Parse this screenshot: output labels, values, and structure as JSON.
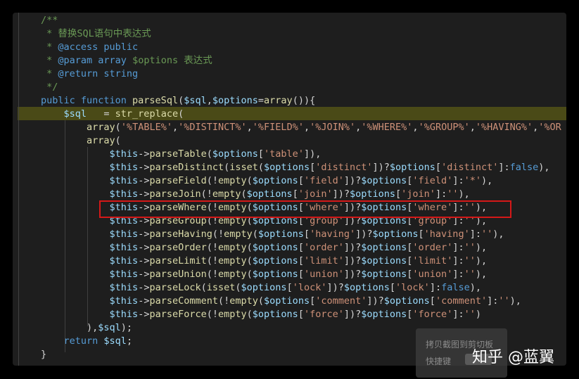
{
  "code": {
    "highlighted_line": 8,
    "lines": [
      [
        [
          "c",
          "/**"
        ]
      ],
      [
        [
          "c",
          " * 替换SQL语句中表达式"
        ]
      ],
      [
        [
          "c",
          " * "
        ],
        [
          "ct",
          "@access public"
        ]
      ],
      [
        [
          "c",
          " * "
        ],
        [
          "ct",
          "@param array "
        ],
        [
          "cv",
          "$options"
        ],
        [
          "c",
          " 表达式"
        ]
      ],
      [
        [
          "c",
          " * "
        ],
        [
          "ct",
          "@return string"
        ]
      ],
      [
        [
          "c",
          " */"
        ]
      ],
      [
        [
          "k",
          "public function "
        ],
        [
          "f",
          "parseSql"
        ],
        [
          "p",
          "("
        ],
        [
          "v",
          "$sql"
        ],
        [
          "p",
          ","
        ],
        [
          "v",
          "$options"
        ],
        [
          "p",
          "="
        ],
        [
          "f",
          "array"
        ],
        [
          "p",
          "()){"
        ]
      ],
      [
        [
          "p",
          "    "
        ],
        [
          "v",
          "$sql"
        ],
        [
          "p",
          "   = "
        ],
        [
          "f",
          "str_replace"
        ],
        [
          "p",
          "("
        ]
      ],
      [
        [
          "p",
          "        "
        ],
        [
          "f",
          "array"
        ],
        [
          "p",
          "("
        ],
        [
          "s",
          "'%TABLE%'"
        ],
        [
          "p",
          ","
        ],
        [
          "s",
          "'%DISTINCT%'"
        ],
        [
          "p",
          ","
        ],
        [
          "s",
          "'%FIELD%'"
        ],
        [
          "p",
          ","
        ],
        [
          "s",
          "'%JOIN%'"
        ],
        [
          "p",
          ","
        ],
        [
          "s",
          "'%WHERE%'"
        ],
        [
          "p",
          ","
        ],
        [
          "s",
          "'%GROUP%'"
        ],
        [
          "p",
          ","
        ],
        [
          "s",
          "'%HAVING%'"
        ],
        [
          "p",
          ","
        ],
        [
          "s",
          "'%OR"
        ]
      ],
      [
        [
          "p",
          "        "
        ],
        [
          "f",
          "array"
        ],
        [
          "p",
          "("
        ]
      ],
      [
        [
          "p",
          "            "
        ],
        [
          "v",
          "$this"
        ],
        [
          "p",
          "->"
        ],
        [
          "f",
          "parseTable"
        ],
        [
          "p",
          "("
        ],
        [
          "v",
          "$options"
        ],
        [
          "p",
          "["
        ],
        [
          "s",
          "'table'"
        ],
        [
          "p",
          "]),"
        ]
      ],
      [
        [
          "p",
          "            "
        ],
        [
          "v",
          "$this"
        ],
        [
          "p",
          "->"
        ],
        [
          "f",
          "parseDistinct"
        ],
        [
          "p",
          "("
        ],
        [
          "f",
          "isset"
        ],
        [
          "p",
          "("
        ],
        [
          "v",
          "$options"
        ],
        [
          "p",
          "["
        ],
        [
          "s",
          "'distinct'"
        ],
        [
          "p",
          "])?"
        ],
        [
          "v",
          "$options"
        ],
        [
          "p",
          "["
        ],
        [
          "s",
          "'distinct'"
        ],
        [
          "p",
          "]:"
        ],
        [
          "b",
          "false"
        ],
        [
          "p",
          "),"
        ]
      ],
      [
        [
          "p",
          "            "
        ],
        [
          "v",
          "$this"
        ],
        [
          "p",
          "->"
        ],
        [
          "f",
          "parseField"
        ],
        [
          "p",
          "(!"
        ],
        [
          "f",
          "empty"
        ],
        [
          "p",
          "("
        ],
        [
          "v",
          "$options"
        ],
        [
          "p",
          "["
        ],
        [
          "s",
          "'field'"
        ],
        [
          "p",
          "])?"
        ],
        [
          "v",
          "$options"
        ],
        [
          "p",
          "["
        ],
        [
          "s",
          "'field'"
        ],
        [
          "p",
          "]:"
        ],
        [
          "s",
          "'*'"
        ],
        [
          "p",
          "),"
        ]
      ],
      [
        [
          "p",
          "            "
        ],
        [
          "v",
          "$this"
        ],
        [
          "p",
          "->"
        ],
        [
          "f",
          "parseJoin"
        ],
        [
          "p",
          "(!"
        ],
        [
          "f",
          "empty"
        ],
        [
          "p",
          "("
        ],
        [
          "v",
          "$options"
        ],
        [
          "p",
          "["
        ],
        [
          "s",
          "'join'"
        ],
        [
          "p",
          "])?"
        ],
        [
          "v",
          "$options"
        ],
        [
          "p",
          "["
        ],
        [
          "s",
          "'join'"
        ],
        [
          "p",
          "]:"
        ],
        [
          "s",
          "''"
        ],
        [
          "p",
          "),"
        ]
      ],
      [
        [
          "p",
          "            "
        ],
        [
          "v",
          "$this"
        ],
        [
          "p",
          "->"
        ],
        [
          "f",
          "parseWhere"
        ],
        [
          "p",
          "(!"
        ],
        [
          "f",
          "empty"
        ],
        [
          "p",
          "("
        ],
        [
          "v",
          "$options"
        ],
        [
          "p",
          "["
        ],
        [
          "s",
          "'where'"
        ],
        [
          "p",
          "])?"
        ],
        [
          "v",
          "$options"
        ],
        [
          "p",
          "["
        ],
        [
          "s",
          "'where'"
        ],
        [
          "p",
          "]:"
        ],
        [
          "s",
          "''"
        ],
        [
          "p",
          "),"
        ]
      ],
      [
        [
          "p",
          "            "
        ],
        [
          "v",
          "$this"
        ],
        [
          "p",
          "->"
        ],
        [
          "f",
          "parseGroup"
        ],
        [
          "p",
          "(!"
        ],
        [
          "f",
          "empty"
        ],
        [
          "p",
          "("
        ],
        [
          "v",
          "$options"
        ],
        [
          "p",
          "["
        ],
        [
          "s",
          "'group'"
        ],
        [
          "p",
          "])?"
        ],
        [
          "v",
          "$options"
        ],
        [
          "p",
          "["
        ],
        [
          "s",
          "'group'"
        ],
        [
          "p",
          "]:"
        ],
        [
          "s",
          "''"
        ],
        [
          "p",
          "),"
        ]
      ],
      [
        [
          "p",
          "            "
        ],
        [
          "v",
          "$this"
        ],
        [
          "p",
          "->"
        ],
        [
          "f",
          "parseHaving"
        ],
        [
          "p",
          "(!"
        ],
        [
          "f",
          "empty"
        ],
        [
          "p",
          "("
        ],
        [
          "v",
          "$options"
        ],
        [
          "p",
          "["
        ],
        [
          "s",
          "'having'"
        ],
        [
          "p",
          "])?"
        ],
        [
          "v",
          "$options"
        ],
        [
          "p",
          "["
        ],
        [
          "s",
          "'having'"
        ],
        [
          "p",
          "]:"
        ],
        [
          "s",
          "''"
        ],
        [
          "p",
          "),"
        ]
      ],
      [
        [
          "p",
          "            "
        ],
        [
          "v",
          "$this"
        ],
        [
          "p",
          "->"
        ],
        [
          "f",
          "parseOrder"
        ],
        [
          "p",
          "(!"
        ],
        [
          "f",
          "empty"
        ],
        [
          "p",
          "("
        ],
        [
          "v",
          "$options"
        ],
        [
          "p",
          "["
        ],
        [
          "s",
          "'order'"
        ],
        [
          "p",
          "])?"
        ],
        [
          "v",
          "$options"
        ],
        [
          "p",
          "["
        ],
        [
          "s",
          "'order'"
        ],
        [
          "p",
          "]:"
        ],
        [
          "s",
          "''"
        ],
        [
          "p",
          "),"
        ]
      ],
      [
        [
          "p",
          "            "
        ],
        [
          "v",
          "$this"
        ],
        [
          "p",
          "->"
        ],
        [
          "f",
          "parseLimit"
        ],
        [
          "p",
          "(!"
        ],
        [
          "f",
          "empty"
        ],
        [
          "p",
          "("
        ],
        [
          "v",
          "$options"
        ],
        [
          "p",
          "["
        ],
        [
          "s",
          "'limit'"
        ],
        [
          "p",
          "])?"
        ],
        [
          "v",
          "$options"
        ],
        [
          "p",
          "["
        ],
        [
          "s",
          "'limit'"
        ],
        [
          "p",
          "]:"
        ],
        [
          "s",
          "''"
        ],
        [
          "p",
          "),"
        ]
      ],
      [
        [
          "p",
          "            "
        ],
        [
          "v",
          "$this"
        ],
        [
          "p",
          "->"
        ],
        [
          "f",
          "parseUnion"
        ],
        [
          "p",
          "(!"
        ],
        [
          "f",
          "empty"
        ],
        [
          "p",
          "("
        ],
        [
          "v",
          "$options"
        ],
        [
          "p",
          "["
        ],
        [
          "s",
          "'union'"
        ],
        [
          "p",
          "])?"
        ],
        [
          "v",
          "$options"
        ],
        [
          "p",
          "["
        ],
        [
          "s",
          "'union'"
        ],
        [
          "p",
          "]:"
        ],
        [
          "s",
          "''"
        ],
        [
          "p",
          "),"
        ]
      ],
      [
        [
          "p",
          "            "
        ],
        [
          "v",
          "$this"
        ],
        [
          "p",
          "->"
        ],
        [
          "f",
          "parseLock"
        ],
        [
          "p",
          "("
        ],
        [
          "f",
          "isset"
        ],
        [
          "p",
          "("
        ],
        [
          "v",
          "$options"
        ],
        [
          "p",
          "["
        ],
        [
          "s",
          "'lock'"
        ],
        [
          "p",
          "])?"
        ],
        [
          "v",
          "$options"
        ],
        [
          "p",
          "["
        ],
        [
          "s",
          "'lock'"
        ],
        [
          "p",
          "]:"
        ],
        [
          "b",
          "false"
        ],
        [
          "p",
          "),"
        ]
      ],
      [
        [
          "p",
          "            "
        ],
        [
          "v",
          "$this"
        ],
        [
          "p",
          "->"
        ],
        [
          "f",
          "parseComment"
        ],
        [
          "p",
          "(!"
        ],
        [
          "f",
          "empty"
        ],
        [
          "p",
          "("
        ],
        [
          "v",
          "$options"
        ],
        [
          "p",
          "["
        ],
        [
          "s",
          "'comment'"
        ],
        [
          "p",
          "])?"
        ],
        [
          "v",
          "$options"
        ],
        [
          "p",
          "["
        ],
        [
          "s",
          "'comment'"
        ],
        [
          "p",
          "]:"
        ],
        [
          "s",
          "''"
        ],
        [
          "p",
          "),"
        ]
      ],
      [
        [
          "p",
          "            "
        ],
        [
          "v",
          "$this"
        ],
        [
          "p",
          "->"
        ],
        [
          "f",
          "parseForce"
        ],
        [
          "p",
          "(!"
        ],
        [
          "f",
          "empty"
        ],
        [
          "p",
          "("
        ],
        [
          "v",
          "$options"
        ],
        [
          "p",
          "["
        ],
        [
          "s",
          "'force'"
        ],
        [
          "p",
          "])?"
        ],
        [
          "v",
          "$options"
        ],
        [
          "p",
          "["
        ],
        [
          "s",
          "'force'"
        ],
        [
          "p",
          "]:"
        ],
        [
          "s",
          "''"
        ],
        [
          "p",
          ")"
        ]
      ],
      [
        [
          "p",
          "        ),"
        ],
        [
          "v",
          "$sql"
        ],
        [
          "p",
          ");"
        ]
      ],
      [
        [
          "p",
          "    "
        ],
        [
          "k",
          "return "
        ],
        [
          "v",
          "$sql"
        ],
        [
          "p",
          ";"
        ]
      ],
      [
        [
          "p",
          "}"
        ]
      ]
    ]
  },
  "toast": {
    "copy_label": "拷贝截图到剪切板",
    "shortcut_label": "快捷键"
  },
  "watermark": "知乎 @蓝翼"
}
